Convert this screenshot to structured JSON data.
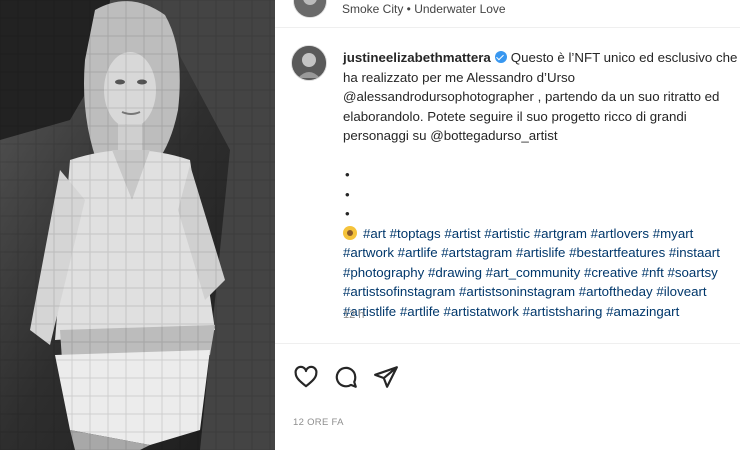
{
  "post": {
    "image_alt": "Black-and-white mosaic portrait",
    "audio": "Smoke City • Underwater Love",
    "username": "justineelizabethmattera",
    "caption_lines": [
      "Questo è l’NFT unico ed esclusivo che",
      "ha realizzato per me Alessandro d’Urso",
      "@alessandrodursophotographer , partendo da un suo ritratto ed",
      "elaborandolo. Potete seguire il suo progetto ricco di grandi",
      "personaggi su @bottegadurso_artist"
    ],
    "bullets": [
      "•",
      "•",
      "•"
    ],
    "hashtag_lines": [
      "#art #toptags #artist #artistic #artgram #artlovers #myart",
      "#artwork #artlife #artstagram #artislife #bestartfeatures #instaart",
      "#photography #drawing #art_community #creative #nft #soartsy",
      "#artistsofinstagram #artistsoninstagram #artoftheday #iloveart",
      "#artistlife #artlife #artistatwork #artistsharing #amazingart"
    ],
    "time_ago": "12 h",
    "date": "12 ORE FA"
  },
  "icons": {
    "like": "heart-icon",
    "comment": "comment-icon",
    "share": "paper-plane-icon",
    "verified": "verified-badge-icon"
  },
  "colors": {
    "link": "#00376b",
    "verified": "#3897f0",
    "muted": "#8e8e8e",
    "text": "#262626"
  }
}
